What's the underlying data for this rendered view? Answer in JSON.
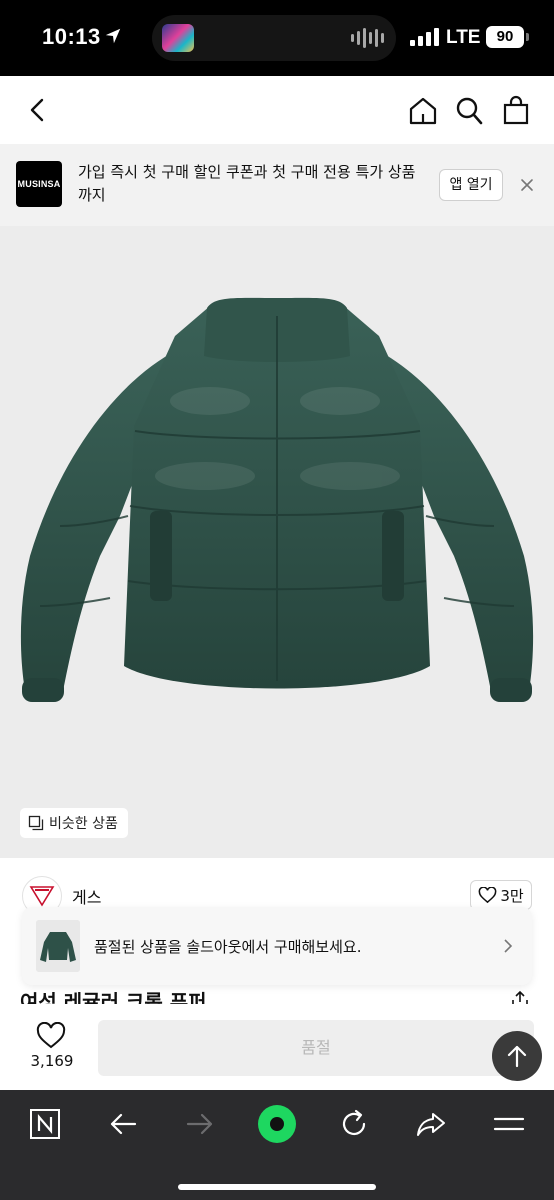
{
  "status_bar": {
    "time": "10:13",
    "network": "LTE",
    "battery": "90"
  },
  "banner": {
    "logo_text": "MUSINSA",
    "message": "가입 즉시 첫 구매 할인 쿠폰과 첫 구매 전용 특가 상품까지",
    "open_app_label": "앱 열기"
  },
  "hero": {
    "similar_label": "비슷한 상품"
  },
  "brand": {
    "name": "게스",
    "likes": "3만"
  },
  "product": {
    "title": "여성 레귤러 크롭 푸퍼"
  },
  "soldout_popup": {
    "message": "품절된 상품을 솔드아웃에서 구매해보세요."
  },
  "purchase_bar": {
    "like_count": "3,169",
    "status_label": "품절"
  },
  "colors": {
    "jacket": "#2e5148",
    "accent": "#1ed760",
    "toolbar_bg": "#2b2b2d"
  },
  "icons": [
    "back-icon",
    "home-icon",
    "search-icon",
    "bag-icon",
    "close-icon",
    "heart-icon",
    "share-icon",
    "chevron-right-icon",
    "arrow-up-icon",
    "n-tab-icon",
    "back-arrow-icon",
    "forward-arrow-icon",
    "green-dot-icon",
    "reload-icon",
    "share-forward-icon",
    "menu-icon"
  ]
}
